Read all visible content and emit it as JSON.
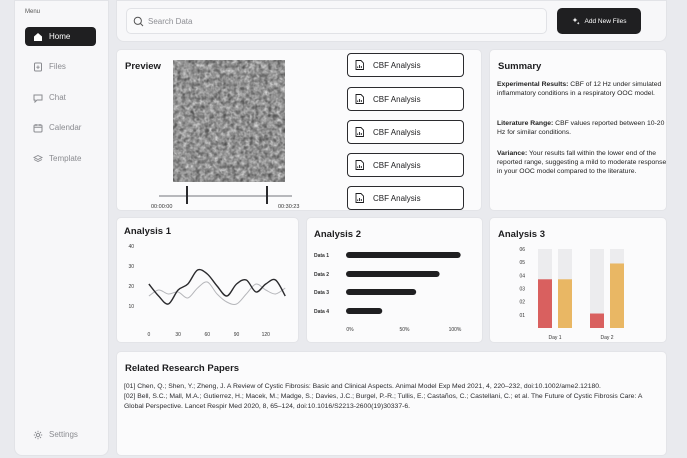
{
  "sidebar": {
    "menu_label": "Menu",
    "items": [
      {
        "label": "Home",
        "icon": "home-icon",
        "active": true
      },
      {
        "label": "Files",
        "icon": "file-icon"
      },
      {
        "label": "Chat",
        "icon": "chat-icon"
      },
      {
        "label": "Calendar",
        "icon": "calendar-icon"
      },
      {
        "label": "Template",
        "icon": "layers-icon"
      }
    ],
    "settings_label": "Settings"
  },
  "search": {
    "placeholder": "Search Data"
  },
  "add_button_label": "Add New Files",
  "preview": {
    "title": "Preview",
    "time_start": "00:00:00",
    "time_end": "00:30:23"
  },
  "analysis_buttons": [
    "CBF Analysis",
    "CBF Analysis",
    "CBF Analysis",
    "CBF Analysis",
    "CBF Analysis"
  ],
  "summary": {
    "title": "Summary",
    "experimental_label": "Experimental Results:",
    "experimental_text": " CBF of 12 Hz under simulated inflammatory conditions in a respiratory OOC model.",
    "literature_label": "Literature Range:",
    "literature_text": " CBF values reported between 10-20 Hz for similar conditions.",
    "variance_label": "Variance:",
    "variance_text": " Your results fall within the lower end of the reported range, suggesting a mild to moderate response in your OOC model compared to the literature."
  },
  "chart_data": [
    {
      "type": "line",
      "title": "Analysis 1",
      "x": [
        0,
        10,
        20,
        30,
        40,
        50,
        60,
        70,
        80,
        90,
        100,
        110,
        120,
        130,
        140
      ],
      "xticks": [
        0,
        30,
        60,
        90,
        120
      ],
      "yticks": [
        10,
        20,
        30,
        40
      ],
      "ylim": [
        0,
        40
      ],
      "xlim": [
        -5,
        150
      ],
      "series": [
        {
          "values": [
            21,
            15,
            11,
            18,
            21,
            28,
            26,
            20,
            15,
            21,
            23,
            17,
            21,
            23,
            15
          ],
          "color": "#2a2a2d"
        },
        {
          "values": [
            15,
            18,
            16,
            17,
            14,
            19,
            22,
            16,
            12,
            11,
            16,
            21,
            18,
            16,
            19
          ],
          "color": "#b5b6ba"
        }
      ]
    },
    {
      "type": "bar",
      "orientation": "horizontal",
      "title": "Analysis 2",
      "categories": [
        "Data 1",
        "Data 2",
        "Data 3",
        "Data 4"
      ],
      "values": [
        98,
        80,
        60,
        31
      ],
      "xticks": [
        "0%",
        "50%",
        "100%"
      ],
      "xlim": [
        0,
        100
      ],
      "color": "#1f1f21"
    },
    {
      "type": "bar",
      "title": "Analysis 3",
      "categories": [
        "Day 1",
        "Day 2"
      ],
      "yticks": [
        "01",
        "02",
        "03",
        "04",
        "05",
        "06"
      ],
      "ylim": [
        0,
        6
      ],
      "series": [
        {
          "color": "#d9605f",
          "values": [
            3.7,
            1.1
          ]
        },
        {
          "color": "#e9b764",
          "values": [
            3.7,
            4.9
          ]
        }
      ],
      "background_value": 6,
      "background_color": "#ececee"
    }
  ],
  "related": {
    "title": "Related Research Papers",
    "refs": [
      "[01] Chen, Q.; Shen, Y.; Zheng, J. A Review of Cystic Fibrosis: Basic and Clinical Aspects. Animal Model Exp Med 2021, 4, 220–232, doi:10.1002/ame2.12180.",
      "[02] Bell, S.C.; Mall, M.A.; Gutierrez, H.; Macek, M.; Madge, S.; Davies, J.C.; Burgel, P.-R.; Tullis, E.; Castaños, C.; Castellani, C.; et al. The Future of Cystic Fibrosis Care: A Global Perspective. Lancet Respir Med 2020, 8, 65–124, doi:10.1016/S2213-2600(19)30337-6."
    ]
  }
}
